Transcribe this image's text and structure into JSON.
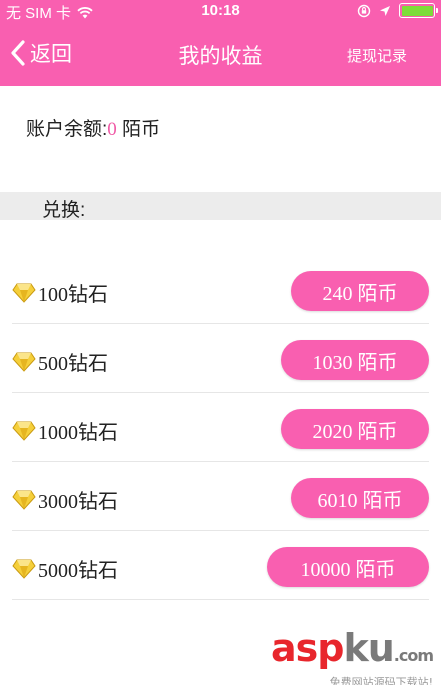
{
  "status_bar": {
    "carrier": "无 SIM 卡",
    "time": "10:18"
  },
  "nav": {
    "back_label": "返回",
    "title": "我的收益",
    "right_link": "提现记录"
  },
  "balance": {
    "label": "账户余额:",
    "value": "0",
    "unit": "陌币"
  },
  "exchange": {
    "label": "兑换:"
  },
  "items": [
    {
      "name": "100钻石",
      "price": "240 陌币"
    },
    {
      "name": "500钻石",
      "price": "1030 陌币"
    },
    {
      "name": "1000钻石",
      "price": "2020 陌币"
    },
    {
      "name": "3000钻石",
      "price": "6010 陌币"
    },
    {
      "name": "5000钻石",
      "price": "10000 陌币"
    }
  ],
  "watermark": {
    "brand_red": "asp",
    "brand_gray": "ku",
    "brand_suffix": ".com",
    "sub": "免费网站源码下载站!"
  },
  "colors": {
    "accent": "#f95fb0",
    "balance_value": "#f05aa6",
    "battery": "#7ddc3a"
  },
  "icons": {
    "back": "chevron-left-icon",
    "diamond": "diamond-icon"
  }
}
